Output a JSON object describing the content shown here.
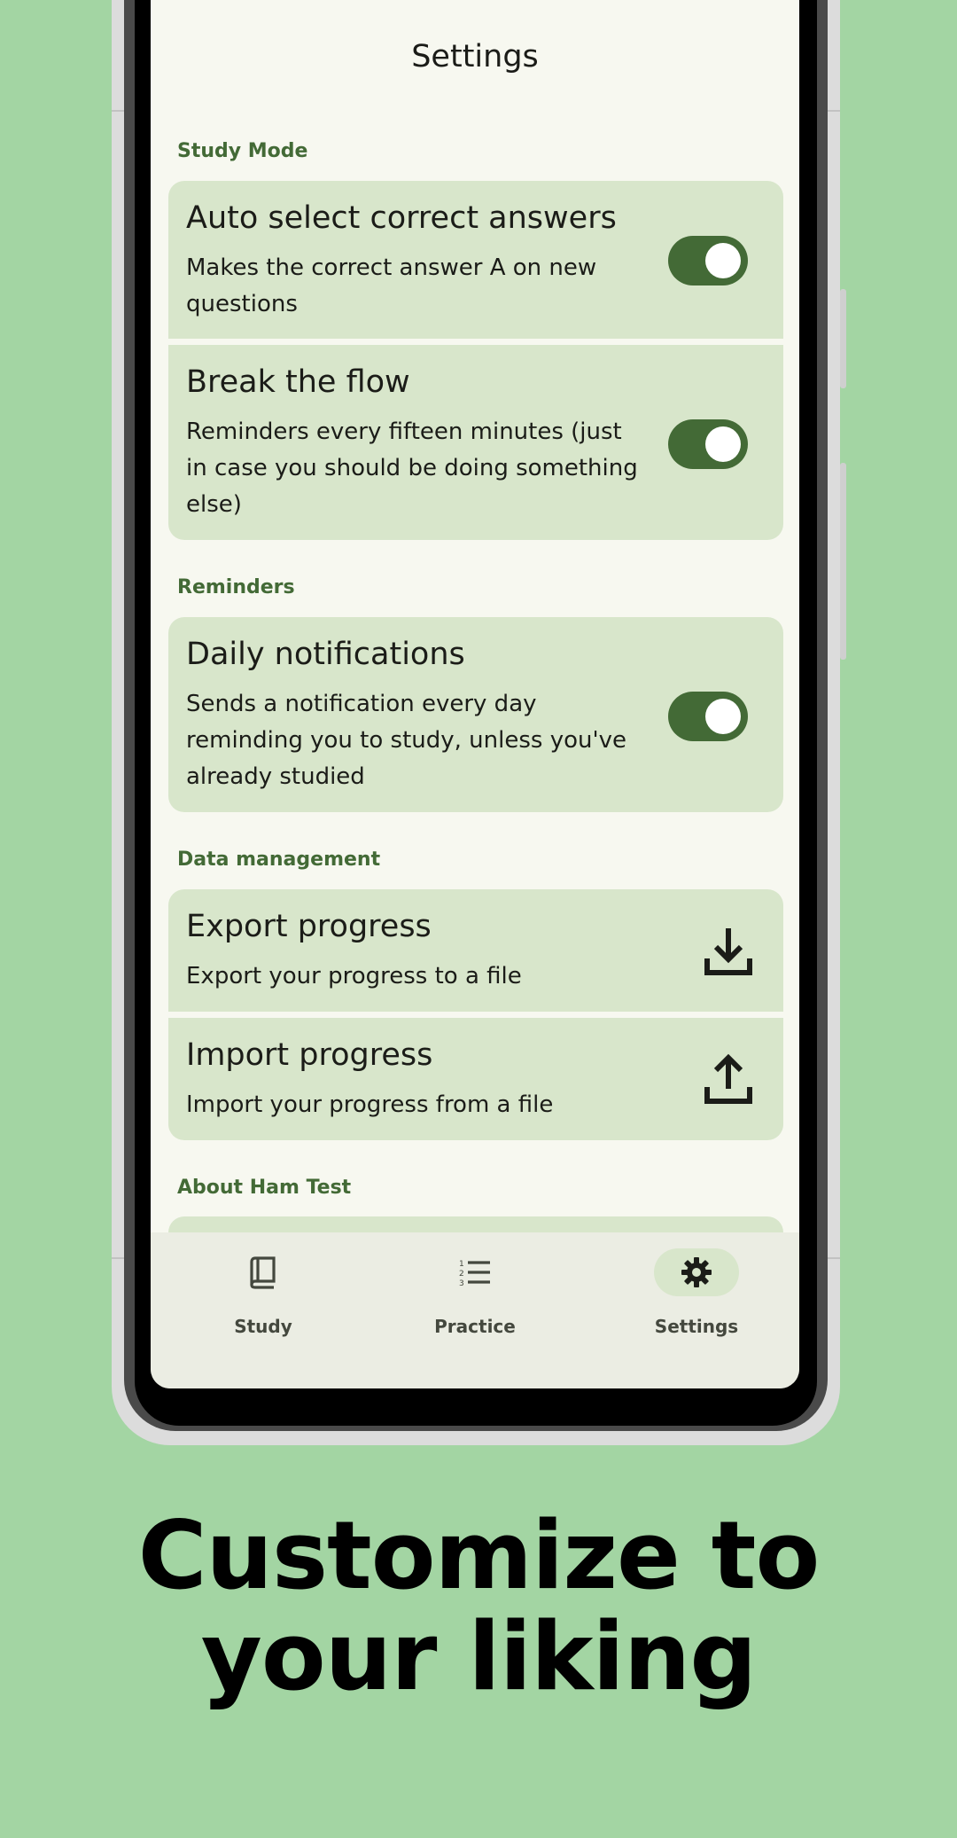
{
  "screen": {
    "title": "Settings"
  },
  "sections": {
    "study_mode": "Study Mode",
    "reminders": "Reminders",
    "data_management": "Data management",
    "about": "About Ham Test"
  },
  "settings": {
    "auto_select": {
      "title": "Auto select correct answers",
      "subtitle": "Makes the correct answer A on new questions",
      "enabled": true
    },
    "break_flow": {
      "title": "Break the flow",
      "subtitle": "Reminders every fifteen minutes (just in case you should be doing something else)",
      "enabled": true
    },
    "daily_notifications": {
      "title": "Daily notifications",
      "subtitle": "Sends a notification every day reminding you to study, unless you've already studied",
      "enabled": true
    },
    "export": {
      "title": "Export progress",
      "subtitle": "Export your progress to a file",
      "icon": "download-icon"
    },
    "import": {
      "title": "Import progress",
      "subtitle": "Import your progress from a file",
      "icon": "upload-icon"
    }
  },
  "nav": {
    "items": [
      {
        "label": "Study",
        "icon": "book-icon",
        "selected": false
      },
      {
        "label": "Practice",
        "icon": "numbered-list-icon",
        "selected": false
      },
      {
        "label": "Settings",
        "icon": "gear-icon",
        "selected": true
      }
    ]
  },
  "headline": {
    "line1": "Customize to",
    "line2": "your liking"
  },
  "colors": {
    "background": "#a3d5a3",
    "accent": "#436a36",
    "card": "#d8e6cb",
    "surface": "#f7f8f0",
    "nav_selected": "#d8e6cb"
  }
}
